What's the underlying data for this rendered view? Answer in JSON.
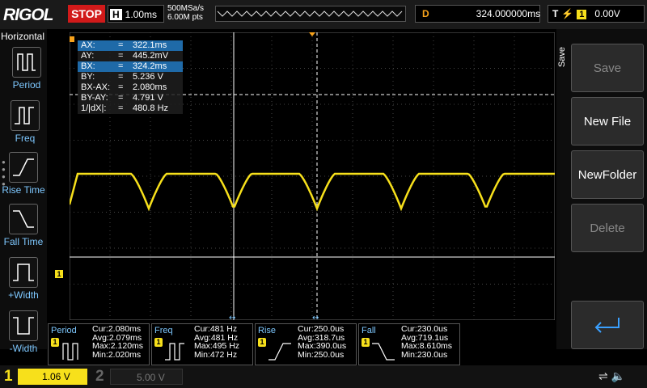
{
  "header": {
    "brand": "RIGOL",
    "run_state": "STOP",
    "timebase_label": "H",
    "timebase_value": "1.00ms",
    "sample_rate": "500MSa/s",
    "memory_depth": "6.00M pts",
    "delay_label": "D",
    "delay_value": "324.000000ms",
    "trigger_label": "T",
    "trigger_edge_icon": "rising-edge-icon",
    "trigger_source": "1",
    "trigger_level": "0.00V"
  },
  "left_menu": {
    "title": "Horizontal",
    "items": [
      {
        "label": "Period",
        "icon": "period-icon"
      },
      {
        "label": "Freq",
        "icon": "frequency-icon"
      },
      {
        "label": "Rise Time",
        "icon": "rise-time-icon"
      },
      {
        "label": "Fall Time",
        "icon": "fall-time-icon"
      },
      {
        "label": "+Width",
        "icon": "positive-width-icon"
      },
      {
        "label": "-Width",
        "icon": "negative-width-icon"
      }
    ]
  },
  "cursor_readout": [
    {
      "key": "AX:",
      "eq": "=",
      "val": "322.1ms",
      "highlight": true
    },
    {
      "key": "AY:",
      "eq": "=",
      "val": "445.2mV",
      "highlight": false
    },
    {
      "key": "BX:",
      "eq": "=",
      "val": "324.2ms",
      "highlight": true
    },
    {
      "key": "BY:",
      "eq": "=",
      "val": "5.236 V",
      "highlight": false
    },
    {
      "key": "BX-AX:",
      "eq": "=",
      "val": "2.080ms",
      "highlight": false
    },
    {
      "key": "BY-AY:",
      "eq": "=",
      "val": "4.791 V",
      "highlight": false
    },
    {
      "key": "1/|dX|:",
      "eq": "=",
      "val": "480.8 Hz",
      "highlight": false
    }
  ],
  "right_menu": {
    "tab": "Save",
    "buttons": [
      {
        "label": "Save",
        "enabled": false
      },
      {
        "label": "New File",
        "enabled": true
      },
      {
        "label": "NewFolder",
        "enabled": true
      },
      {
        "label": "Delete",
        "enabled": false
      }
    ],
    "enter_icon": "enter-return-icon"
  },
  "measurements": [
    {
      "title": "Period",
      "source": "1",
      "cur": "Cur:2.080ms",
      "avg": "Avg:2.079ms",
      "max": "Max:2.120ms",
      "min": "Min:2.020ms"
    },
    {
      "title": "Freq",
      "source": "1",
      "cur": "Cur:481 Hz",
      "avg": "Avg:481 Hz",
      "max": "Max:495 Hz",
      "min": "Min:472 Hz"
    },
    {
      "title": "Rise",
      "source": "1",
      "cur": "Cur:250.0us",
      "avg": "Avg:318.7us",
      "max": "Max:390.0us",
      "min": "Min:250.0us"
    },
    {
      "title": "Fall",
      "source": "1",
      "cur": "Cur:230.0us",
      "avg": "Avg:719.1us",
      "max": "Max:8.610ms",
      "min": "Min:230.0us"
    }
  ],
  "channels": {
    "ch1_number": "1",
    "ch1_scale": "1.06 V",
    "ch2_number": "2",
    "ch2_scale": "5.00 V"
  },
  "colors": {
    "trace": "#f7e01b",
    "accent_orange": "#f7a21b",
    "stop_red": "#d11a1a",
    "highlight_blue": "#1f6aa8"
  }
}
